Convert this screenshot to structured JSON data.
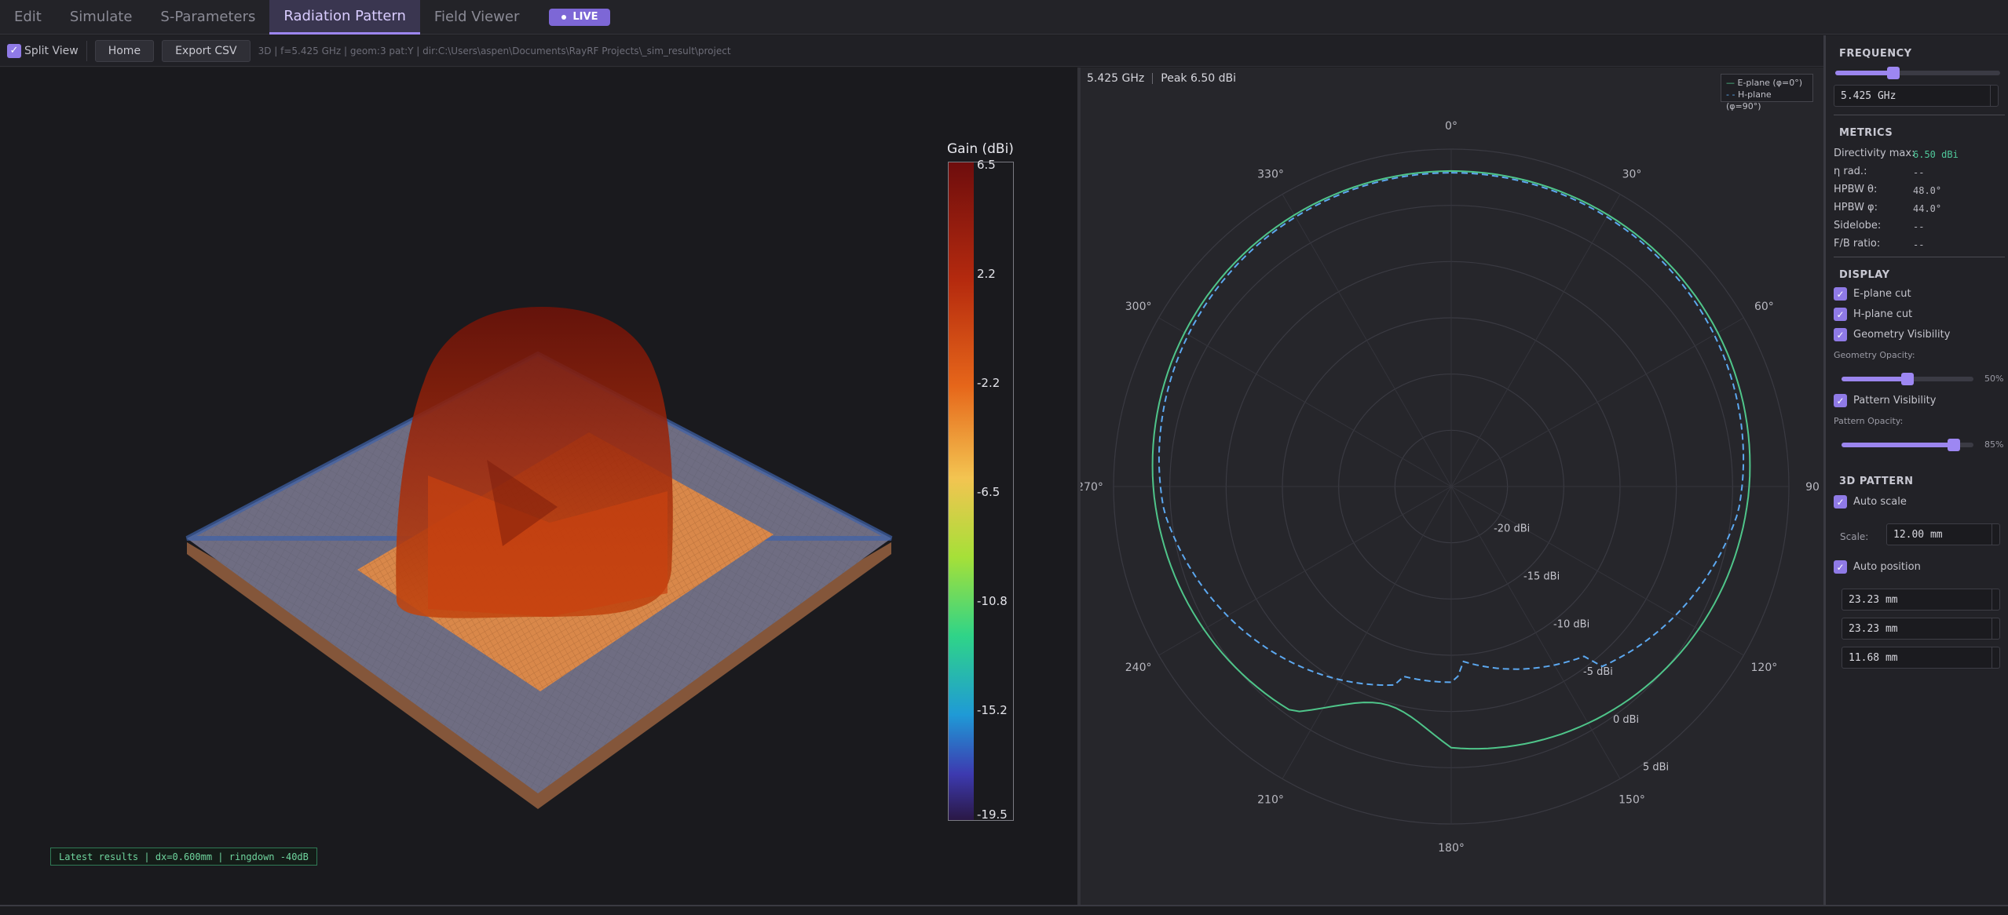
{
  "tabs": [
    {
      "label": "Edit"
    },
    {
      "label": "Simulate"
    },
    {
      "label": "S-Parameters"
    },
    {
      "label": "Radiation Pattern"
    },
    {
      "label": "Field Viewer"
    }
  ],
  "live_label": "LIVE",
  "toolbar": {
    "split_view_label": "Split View",
    "home_label": "Home",
    "export_label": "Export CSV",
    "info": "3D | f=5.425 GHz | geom:3 pat:Y | dir:C:\\Users\\aspen\\Documents\\RayRF Projects\\_sim_result\\project"
  },
  "view3d": {
    "status": "Latest results | dx=0.600mm | ringdown -40dB",
    "colorbar": {
      "title": "Gain (dBi)",
      "ticks": [
        "6.5",
        "2.2",
        "-2.2",
        "-6.5",
        "-10.8",
        "-15.2",
        "-19.5"
      ]
    }
  },
  "polar": {
    "freq": "5.425 GHz",
    "peak": "Peak 6.50 dBi",
    "legend": {
      "e": "E-plane (φ=0°)",
      "h": "H-plane (φ=90°)"
    },
    "angle_labels": [
      "0°",
      "30°",
      "60°",
      "90",
      "120°",
      "150°",
      "180°",
      "210°",
      "240°",
      "270°",
      "300°",
      "330°"
    ],
    "ring_labels": [
      "-20 dBi",
      "-15 dBi",
      "-10 dBi",
      "-5 dBi",
      "0 dBi",
      "5 dBi"
    ],
    "colors": {
      "e": "#4fc58a",
      "h": "#5ca8f0"
    }
  },
  "panel": {
    "frequency_title": "FREQUENCY",
    "frequency_value": "5.425 GHz",
    "frequency_slider": 0.35,
    "metrics_title": "METRICS",
    "metrics": [
      {
        "k": "Directivity max:",
        "v": "6.50 dBi"
      },
      {
        "k": "η rad.:",
        "v": "--"
      },
      {
        "k": "HPBW θ:",
        "v": "48.0°"
      },
      {
        "k": "HPBW φ:",
        "v": "44.0°"
      },
      {
        "k": "Sidelobe:",
        "v": "--"
      },
      {
        "k": "F/B ratio:",
        "v": "--"
      }
    ],
    "display_title": "DISPLAY",
    "e_plane_label": "E-plane cut",
    "h_plane_label": "H-plane cut",
    "geom_vis_label": "Geometry Visibility",
    "geom_opacity_label": "Geometry Opacity:",
    "geom_opacity_pct": "50%",
    "geom_opacity": 0.5,
    "pattern_vis_label": "Pattern Visibility",
    "pattern_opacity_label": "Pattern Opacity:",
    "pattern_opacity_pct": "85%",
    "pattern_opacity": 0.85,
    "pattern3d_title": "3D PATTERN",
    "auto_scale_label": "Auto scale",
    "scale_label": "Scale:",
    "scale_value": "12.00 mm",
    "auto_position_label": "Auto position",
    "pos_x": "23.23 mm",
    "pos_y": "23.23 mm",
    "pos_z": "11.68 mm"
  }
}
